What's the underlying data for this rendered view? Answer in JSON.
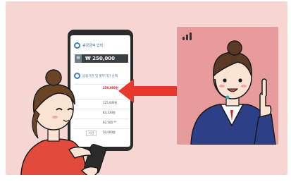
{
  "tablet": {
    "section1_title": "송금금액 입력",
    "amount_label": "₩",
    "amount_value": "₩ 250,000",
    "section2_title": "금융기관 및 할부기간 선택",
    "rows": [
      "250,000원",
      "125,000원",
      "83,333원",
      "62,500 **",
      "50,000원"
    ],
    "side_label": "기간"
  },
  "colors": {
    "background": "#f6d6d3",
    "arrow": "#e8392c",
    "card": "#e79b9b",
    "accent_blue": "#3d7fc1",
    "highlight_red": "#d9241f"
  },
  "icons": [
    "signal-icon",
    "arrow-left-icon",
    "dollar-icon"
  ]
}
